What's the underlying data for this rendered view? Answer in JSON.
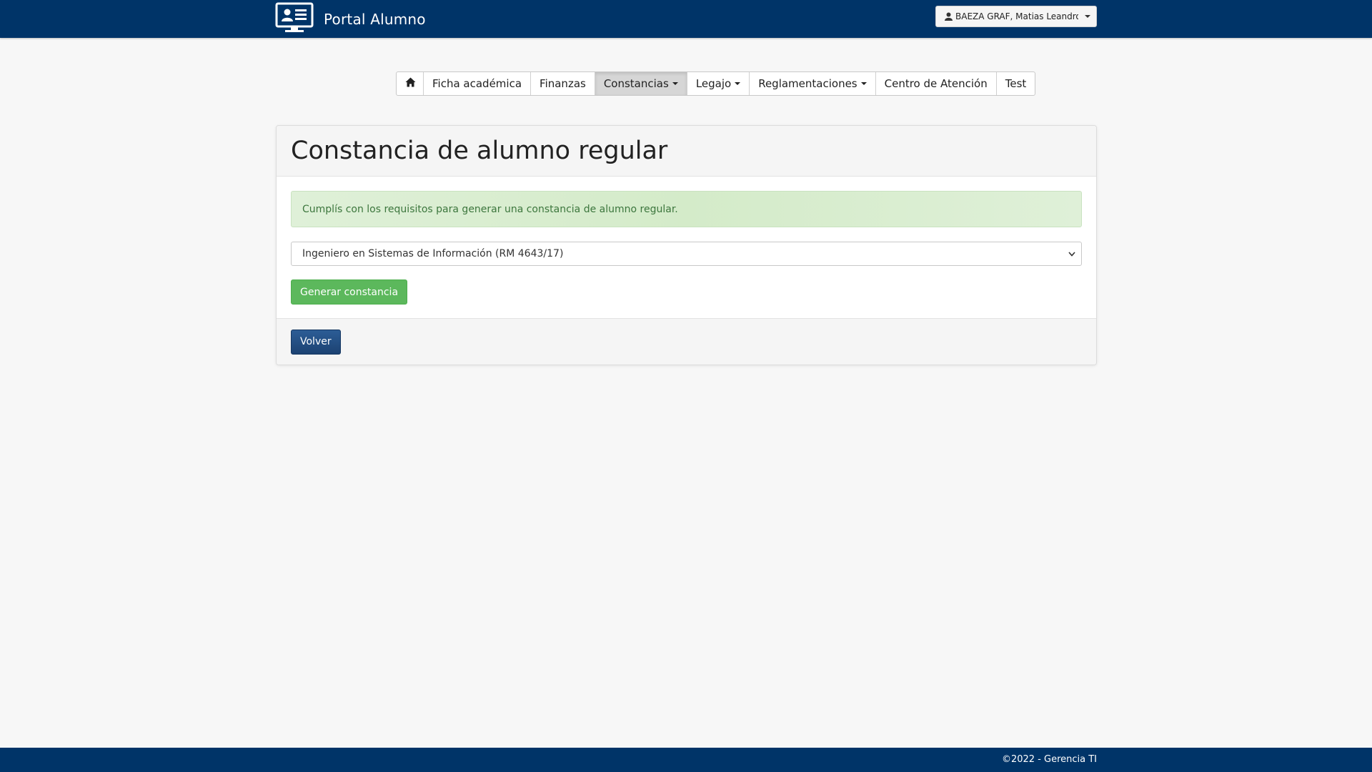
{
  "header": {
    "brand": "Portal Alumno",
    "brand_icon": "monitor-user-icon",
    "user_name": "BAEZA GRAF, Matias Leandro",
    "user_icon": "user-icon"
  },
  "nav": {
    "home_icon": "home-icon",
    "items": [
      {
        "label": "Ficha académica"
      },
      {
        "label": "Finanzas"
      },
      {
        "label": "Constancias",
        "dropdown": true,
        "active": true
      },
      {
        "label": "Legajo",
        "dropdown": true
      },
      {
        "label": "Reglamentaciones",
        "dropdown": true
      },
      {
        "label": "Centro de Atención"
      },
      {
        "label": "Test"
      }
    ]
  },
  "panel": {
    "title": "Constancia de alumno regular",
    "alert": "Cumplís con los requisitos para generar una constancia de alumno regular.",
    "select_value": "Ingeniero en Sistemas de Información (RM 4643/17)",
    "generate_label": "Generar constancia",
    "back_label": "Volver"
  },
  "footer": {
    "text": "©2022 - Gerencia TI"
  },
  "colors": {
    "primary": "#003468",
    "success": "#5cb85c",
    "background": "#f7f7f7"
  }
}
